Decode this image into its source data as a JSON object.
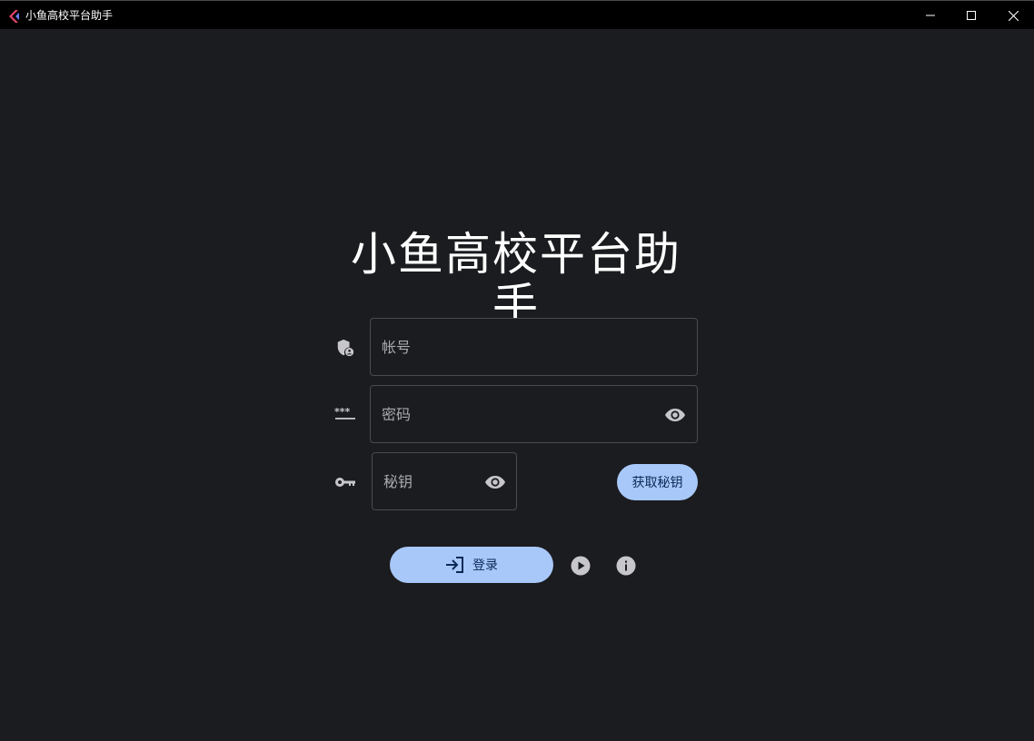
{
  "window": {
    "title": "小鱼高校平台助手",
    "controls": [
      "minimize",
      "maximize",
      "close"
    ]
  },
  "main": {
    "heading": "小鱼高校平台助手",
    "account": {
      "placeholder": "帐号",
      "value": "",
      "icon": "shield-person-icon"
    },
    "password": {
      "placeholder": "密码",
      "value": "",
      "icon": "password-dots-icon",
      "toggle_icon": "eye-icon"
    },
    "secret_key": {
      "placeholder": "秘钥",
      "value": "",
      "icon": "key-icon",
      "toggle_icon": "eye-icon"
    },
    "get_key_label": "获取秘钥",
    "login_label": "登录",
    "login_icon": "login-arrow-icon",
    "play_icon": "play-circle-icon",
    "info_icon": "info-icon"
  },
  "colors": {
    "background": "#1b1c1f",
    "titlebar": "#000000",
    "accent": "#a8c8fa",
    "accent_text": "#0b2a56",
    "field_border": "#4a4b50",
    "icon": "#c7c7cb"
  }
}
